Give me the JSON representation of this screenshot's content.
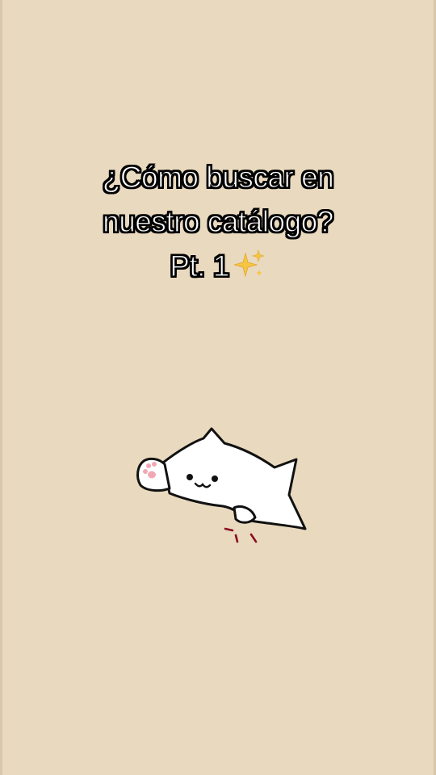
{
  "caption": {
    "line1": "¿Cómo buscar en",
    "line2": "nuestro catálogo?",
    "line3": "Pt. 1"
  },
  "icons": {
    "sparkle": "sparkles-icon",
    "cat": "bongo-cat-illustration"
  },
  "colors": {
    "background": "#e9d9be",
    "caption_fill": "#ffffff",
    "caption_outline": "#000000",
    "sparkle": "#f6c542",
    "paw_pads": "#f2a7b5",
    "tap_marks": "#8b0d22"
  }
}
